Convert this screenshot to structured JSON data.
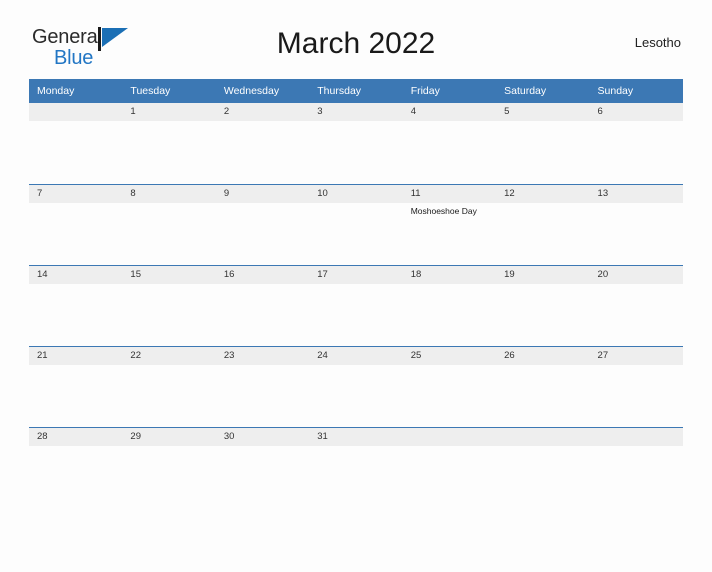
{
  "brand": {
    "name_part1": "General",
    "name_part2": "Blue",
    "logo_icon": "blue-flag-triangle-icon",
    "color_primary": "#2276c4",
    "color_text": "#2b2b2b"
  },
  "header": {
    "title": "March 2022",
    "country": "Lesotho"
  },
  "calendar": {
    "header_bg": "#3c78b4",
    "band_bg": "#eeeeee",
    "weekdays": [
      "Monday",
      "Tuesday",
      "Wednesday",
      "Thursday",
      "Friday",
      "Saturday",
      "Sunday"
    ],
    "weeks": [
      [
        {
          "date": "",
          "events": []
        },
        {
          "date": "1",
          "events": []
        },
        {
          "date": "2",
          "events": []
        },
        {
          "date": "3",
          "events": []
        },
        {
          "date": "4",
          "events": []
        },
        {
          "date": "5",
          "events": []
        },
        {
          "date": "6",
          "events": []
        }
      ],
      [
        {
          "date": "7",
          "events": []
        },
        {
          "date": "8",
          "events": []
        },
        {
          "date": "9",
          "events": []
        },
        {
          "date": "10",
          "events": []
        },
        {
          "date": "11",
          "events": [
            "Moshoeshoe Day"
          ]
        },
        {
          "date": "12",
          "events": []
        },
        {
          "date": "13",
          "events": []
        }
      ],
      [
        {
          "date": "14",
          "events": []
        },
        {
          "date": "15",
          "events": []
        },
        {
          "date": "16",
          "events": []
        },
        {
          "date": "17",
          "events": []
        },
        {
          "date": "18",
          "events": []
        },
        {
          "date": "19",
          "events": []
        },
        {
          "date": "20",
          "events": []
        }
      ],
      [
        {
          "date": "21",
          "events": []
        },
        {
          "date": "22",
          "events": []
        },
        {
          "date": "23",
          "events": []
        },
        {
          "date": "24",
          "events": []
        },
        {
          "date": "25",
          "events": []
        },
        {
          "date": "26",
          "events": []
        },
        {
          "date": "27",
          "events": []
        }
      ],
      [
        {
          "date": "28",
          "events": []
        },
        {
          "date": "29",
          "events": []
        },
        {
          "date": "30",
          "events": []
        },
        {
          "date": "31",
          "events": []
        },
        {
          "date": "",
          "events": []
        },
        {
          "date": "",
          "events": []
        },
        {
          "date": "",
          "events": []
        }
      ]
    ]
  }
}
